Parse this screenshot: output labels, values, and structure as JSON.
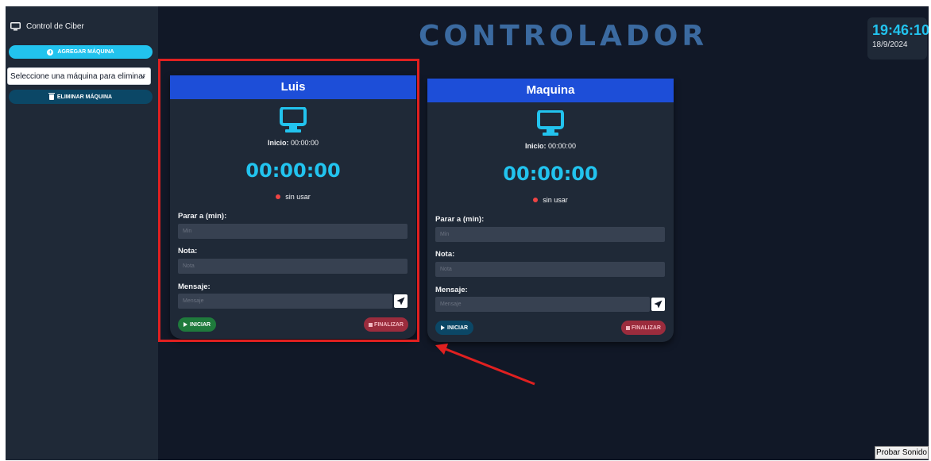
{
  "sidebar": {
    "title": "Control de Ciber",
    "add_button": "AGREGAR MÁQUINA",
    "select_value": "Seleccione una máquina para eliminar",
    "delete_button": "ELIMINAR MÁQUINA"
  },
  "header": {
    "title": "CONTROLADOR"
  },
  "clock": {
    "time": "19:46:10",
    "date": "18/9/2024"
  },
  "cards": [
    {
      "name": "Luis",
      "inicio_label": "Inicio:",
      "inicio_value": "00:00:00",
      "timer": "00:00:00",
      "status": "sin usar",
      "stop_label": "Parar a (min):",
      "stop_placeholder": "Min",
      "note_label": "Nota:",
      "note_placeholder": "Nota",
      "message_label": "Mensaje:",
      "message_placeholder": "Mensaje",
      "start_button": "INICIAR",
      "end_button": "FINALIZAR",
      "start_color": "#1f7a3c"
    },
    {
      "name": "Maquina",
      "inicio_label": "Inicio:",
      "inicio_value": "00:00:00",
      "timer": "00:00:00",
      "status": "sin usar",
      "stop_label": "Parar a (min):",
      "stop_placeholder": "Min",
      "note_label": "Nota:",
      "note_placeholder": "Nota",
      "message_label": "Mensaje:",
      "message_placeholder": "Mensaje",
      "start_button": "INICIAR",
      "end_button": "FINALIZAR",
      "start_color": "#0b4766"
    }
  ],
  "sound_button": "Probar Sonido",
  "colors": {
    "background": "#111827",
    "panel": "#1f2937",
    "accent": "#22c3ee",
    "card_header": "#1d4ed8",
    "annotation": "#e02020"
  }
}
